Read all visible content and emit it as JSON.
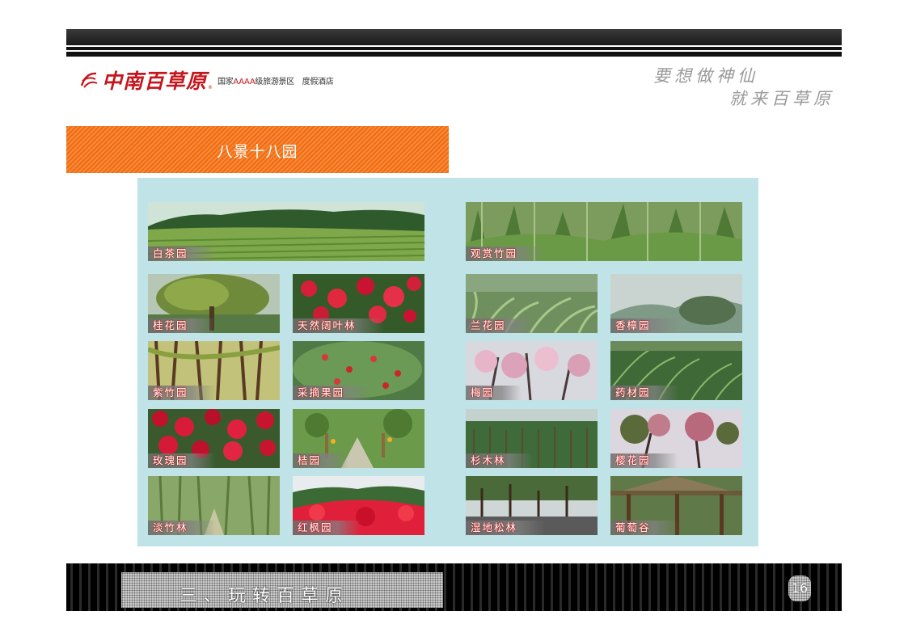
{
  "header": {
    "logo_text": "中南百草原",
    "logo_registered": "®",
    "logo_subtitle_prefix": "国家",
    "logo_subtitle_aaaa": "AAAA",
    "logo_subtitle_rest": "级旅游景区　度假酒店",
    "slogan_line1": "要想做神仙",
    "slogan_line2": "就来百草原"
  },
  "section_title": "八景十八园",
  "gardens": [
    {
      "label": "白茶园",
      "theme": "tea-plantation"
    },
    {
      "label": "观赏竹园",
      "theme": "bamboo-garden"
    },
    {
      "label": "桂花园",
      "theme": "osmanthus-tree"
    },
    {
      "label": "天然阔叶林",
      "theme": "red-azalea"
    },
    {
      "label": "兰花园",
      "theme": "orchid-garden"
    },
    {
      "label": "香樟园",
      "theme": "misty-camphor"
    },
    {
      "label": "紫竹园",
      "theme": "purple-bamboo"
    },
    {
      "label": "采摘果园",
      "theme": "fruit-orchard"
    },
    {
      "label": "梅园",
      "theme": "plum-blossom"
    },
    {
      "label": "药材园",
      "theme": "herb-garden"
    },
    {
      "label": "玫瑰园",
      "theme": "rose-garden"
    },
    {
      "label": "桔园",
      "theme": "orange-grove"
    },
    {
      "label": "杉木林",
      "theme": "fir-forest"
    },
    {
      "label": "樱花园",
      "theme": "cherry-blossom"
    },
    {
      "label": "淡竹林",
      "theme": "light-bamboo"
    },
    {
      "label": "红枫园",
      "theme": "red-maple"
    },
    {
      "label": "湿地松林",
      "theme": "wetland-pine"
    },
    {
      "label": "葡萄谷",
      "theme": "grape-valley"
    }
  ],
  "footer": {
    "chapter_title": "三、玩转百草原",
    "page_number": "16"
  }
}
